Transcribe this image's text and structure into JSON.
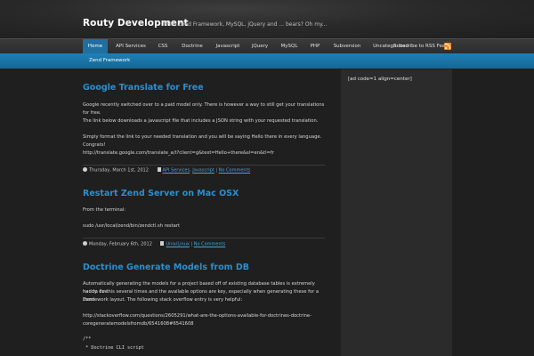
{
  "header": {
    "site_title": "Routy Development",
    "tagline": "PHP, Zend Framework, MySQL, jQuery and ... bears? Oh my..."
  },
  "nav": {
    "items": [
      {
        "label": "Home",
        "active": true
      },
      {
        "label": "API Services"
      },
      {
        "label": "CSS"
      },
      {
        "label": "Doctrine"
      },
      {
        "label": "Javascript"
      },
      {
        "label": "jQuery"
      },
      {
        "label": "MySQL"
      },
      {
        "label": "PHP"
      },
      {
        "label": "Subversion"
      },
      {
        "label": "Uncategorized"
      }
    ],
    "subscribe_label": "Subscribe to RSS Feed",
    "rss_icon": "rss-icon"
  },
  "subnav": {
    "items": [
      {
        "label": "Zend Framework"
      }
    ]
  },
  "posts": [
    {
      "title": "Google Translate for Free",
      "paragraphs": [
        "Google recently switched over to a paid model only. There is however a way to still get your translations for free.",
        "The link below downloads a javascript file that includes a JSON string with your requested translation.",
        "Simply format the link to your needed translation and you will be saying Hello there in every language. Congrats!",
        "http://translate.google.com/translate_a/t?client=g&text=Hello+there&sl=en&tl=fr"
      ],
      "meta": {
        "date": "Thursday, March 1st, 2012",
        "categories": [
          "API Services",
          "Javascript"
        ],
        "comments": "No Comments"
      }
    },
    {
      "title": "Restart Zend Server on Mac OSX",
      "paragraphs": [
        "From the terminal:",
        "sudo /usr/local/zend/bin/zendctl.sh restart"
      ],
      "meta": {
        "date": "Monday, February 6th, 2012",
        "categories": [
          "Unix/Linux"
        ],
        "comments": "No Comments"
      }
    },
    {
      "title": "Doctrine Generate Models from DB",
      "paragraphs": [
        "Automatically generating the models for a project based off of existing database tables is extremely handy. I've",
        "had to do this several times and the available options are key, especially when generating these for a Zend",
        "Framework layout. The following stack overflow entry is very helpful:",
        "http://stackoverflow.com/questions/2605291/what-are-the-options-available-for-doctrines-doctrine-",
        "coregeneratemodelsfromdb/6541608#6541608"
      ],
      "code": [
        "/**",
        " * Doctrine CLI script"
      ]
    }
  ],
  "sidebar": {
    "text": "[ad code=1 align=center]"
  }
}
